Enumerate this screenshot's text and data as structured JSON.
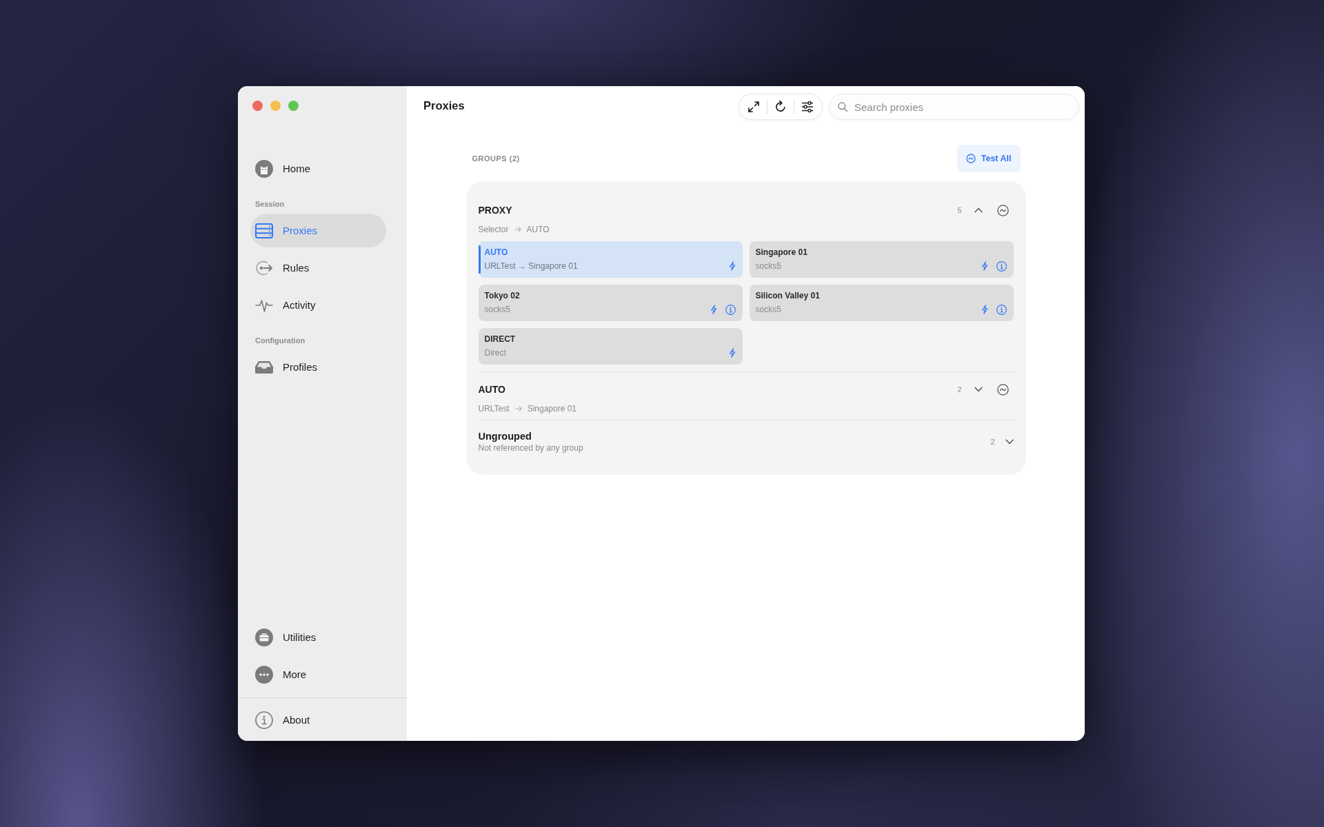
{
  "header": {
    "title": "Proxies",
    "search": {
      "placeholder": "Search proxies"
    }
  },
  "sidebar": {
    "top_items": [
      {
        "label": "Home",
        "selected": false
      }
    ],
    "sections": [
      {
        "heading": "Session",
        "items": [
          {
            "label": "Proxies",
            "selected": true
          },
          {
            "label": "Rules",
            "selected": false
          },
          {
            "label": "Activity",
            "selected": false
          }
        ]
      },
      {
        "heading": "Configuration",
        "items": [
          {
            "label": "Profiles",
            "selected": false
          }
        ]
      }
    ],
    "bottom_items": [
      {
        "label": "Utilities",
        "selected": false
      },
      {
        "label": "More",
        "selected": false
      }
    ],
    "footer_items": [
      {
        "label": "About",
        "selected": false
      }
    ]
  },
  "groups_section": {
    "heading": "GROUPS (2)",
    "test_all_button": "Test All"
  },
  "groups": [
    {
      "name": "PROXY",
      "count": "5",
      "expanded": true,
      "type": "Selector",
      "current": "AUTO",
      "proxies": [
        {
          "name": "AUTO",
          "detail": "URLTest → Singapore 01",
          "selected": true,
          "info_button": false
        },
        {
          "name": "Singapore 01",
          "detail": "socks5",
          "selected": false,
          "info_button": true
        },
        {
          "name": "Tokyo 02",
          "detail": "socks5",
          "selected": false,
          "info_button": true
        },
        {
          "name": "Silicon Valley 01",
          "detail": "socks5",
          "selected": false,
          "info_button": true
        },
        {
          "name": "DIRECT",
          "detail": "Direct",
          "selected": false,
          "info_button": false
        }
      ]
    },
    {
      "name": "AUTO",
      "count": "2",
      "expanded": false,
      "type": "URLTest",
      "current": "Singapore 01"
    }
  ],
  "ungrouped": {
    "name": "Ungrouped",
    "description": "Not referenced by any group",
    "count": "2",
    "expanded": false
  }
}
